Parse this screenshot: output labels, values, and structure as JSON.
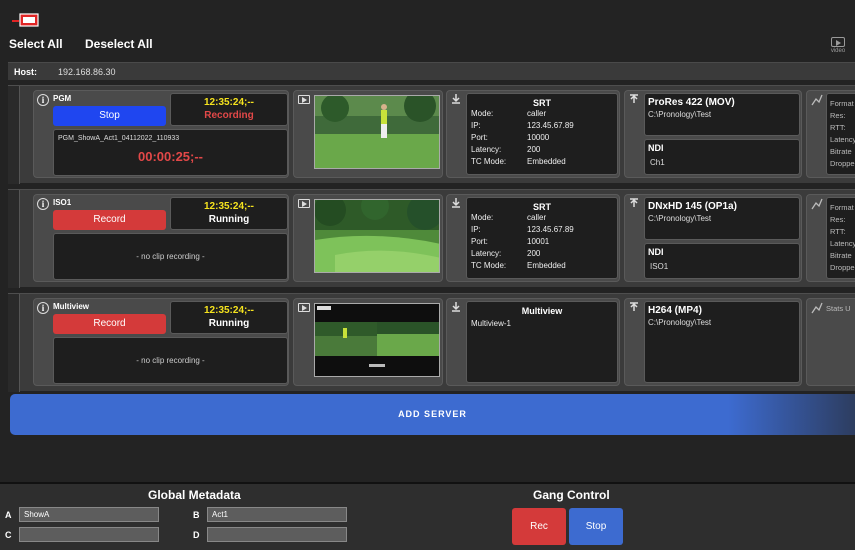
{
  "toolbar": {
    "select_all": "Select All",
    "deselect_all": "Deselect All",
    "video_label": "video"
  },
  "host": {
    "label": "Host:",
    "value": "192.168.86.30"
  },
  "servers": [
    {
      "name": "PGM",
      "button_label": "Stop",
      "button_color": "#1f46f0",
      "timecode": "12:35:24;--",
      "status": "Recording",
      "clip_name": "PGM_ShowA_Act1_04112022_110933",
      "clip_time": "00:00:25;--",
      "network": {
        "title": "SRT",
        "fields": [
          {
            "k": "Mode:",
            "v": "caller"
          },
          {
            "k": "IP:",
            "v": "123.45.67.89"
          },
          {
            "k": "Port:",
            "v": "10000"
          },
          {
            "k": "Latency:",
            "v": "200"
          },
          {
            "k": "TC Mode:",
            "v": "Embedded"
          }
        ]
      },
      "output": {
        "format": "ProRes 422 (MOV)",
        "path": "C:\\Pronology\\Test",
        "ndi_label": "NDI",
        "ndi_channel": "Ch1"
      },
      "stats": [
        "Format",
        "Res:",
        "RTT:",
        "Latency",
        "Bitrate",
        "Dropped"
      ]
    },
    {
      "name": "ISO1",
      "button_label": "Record",
      "button_color": "#d43a3a",
      "timecode": "12:35:24;--",
      "status": "Running",
      "clip_none": "- no clip recording -",
      "network": {
        "title": "SRT",
        "fields": [
          {
            "k": "Mode:",
            "v": "caller"
          },
          {
            "k": "IP:",
            "v": "123.45.67.89"
          },
          {
            "k": "Port:",
            "v": "10001"
          },
          {
            "k": "Latency:",
            "v": "200"
          },
          {
            "k": "TC Mode:",
            "v": "Embedded"
          }
        ]
      },
      "output": {
        "format": "DNxHD 145 (OP1a)",
        "path": "C:\\Pronology\\Test",
        "ndi_label": "NDI",
        "ndi_channel": "ISO1"
      },
      "stats": [
        "Format",
        "Res:",
        "RTT:",
        "Latency",
        "Bitrate",
        "Dropped"
      ]
    },
    {
      "name": "Multiview",
      "button_label": "Record",
      "button_color": "#d43a3a",
      "timecode": "12:35:24;--",
      "status": "Running",
      "clip_none": "- no clip recording -",
      "network": {
        "title": "Multiview",
        "subtitle": "Multiview-1"
      },
      "output": {
        "format": "H264 (MP4)",
        "path": "C:\\Pronology\\Test"
      },
      "stats_label": "Stats U"
    }
  ],
  "add_server": "ADD SERVER",
  "global_metadata": {
    "title": "Global Metadata",
    "fields": [
      {
        "label": "A",
        "value": "ShowA"
      },
      {
        "label": "B",
        "value": "Act1"
      },
      {
        "label": "C",
        "value": ""
      },
      {
        "label": "D",
        "value": ""
      }
    ]
  },
  "gang_control": {
    "title": "Gang Control",
    "rec": "Rec",
    "stop": "Stop"
  },
  "colors": {
    "accent_blue": "#3d6bd0",
    "record_red": "#d43a3a",
    "timecode_yellow": "#f5e31e"
  }
}
